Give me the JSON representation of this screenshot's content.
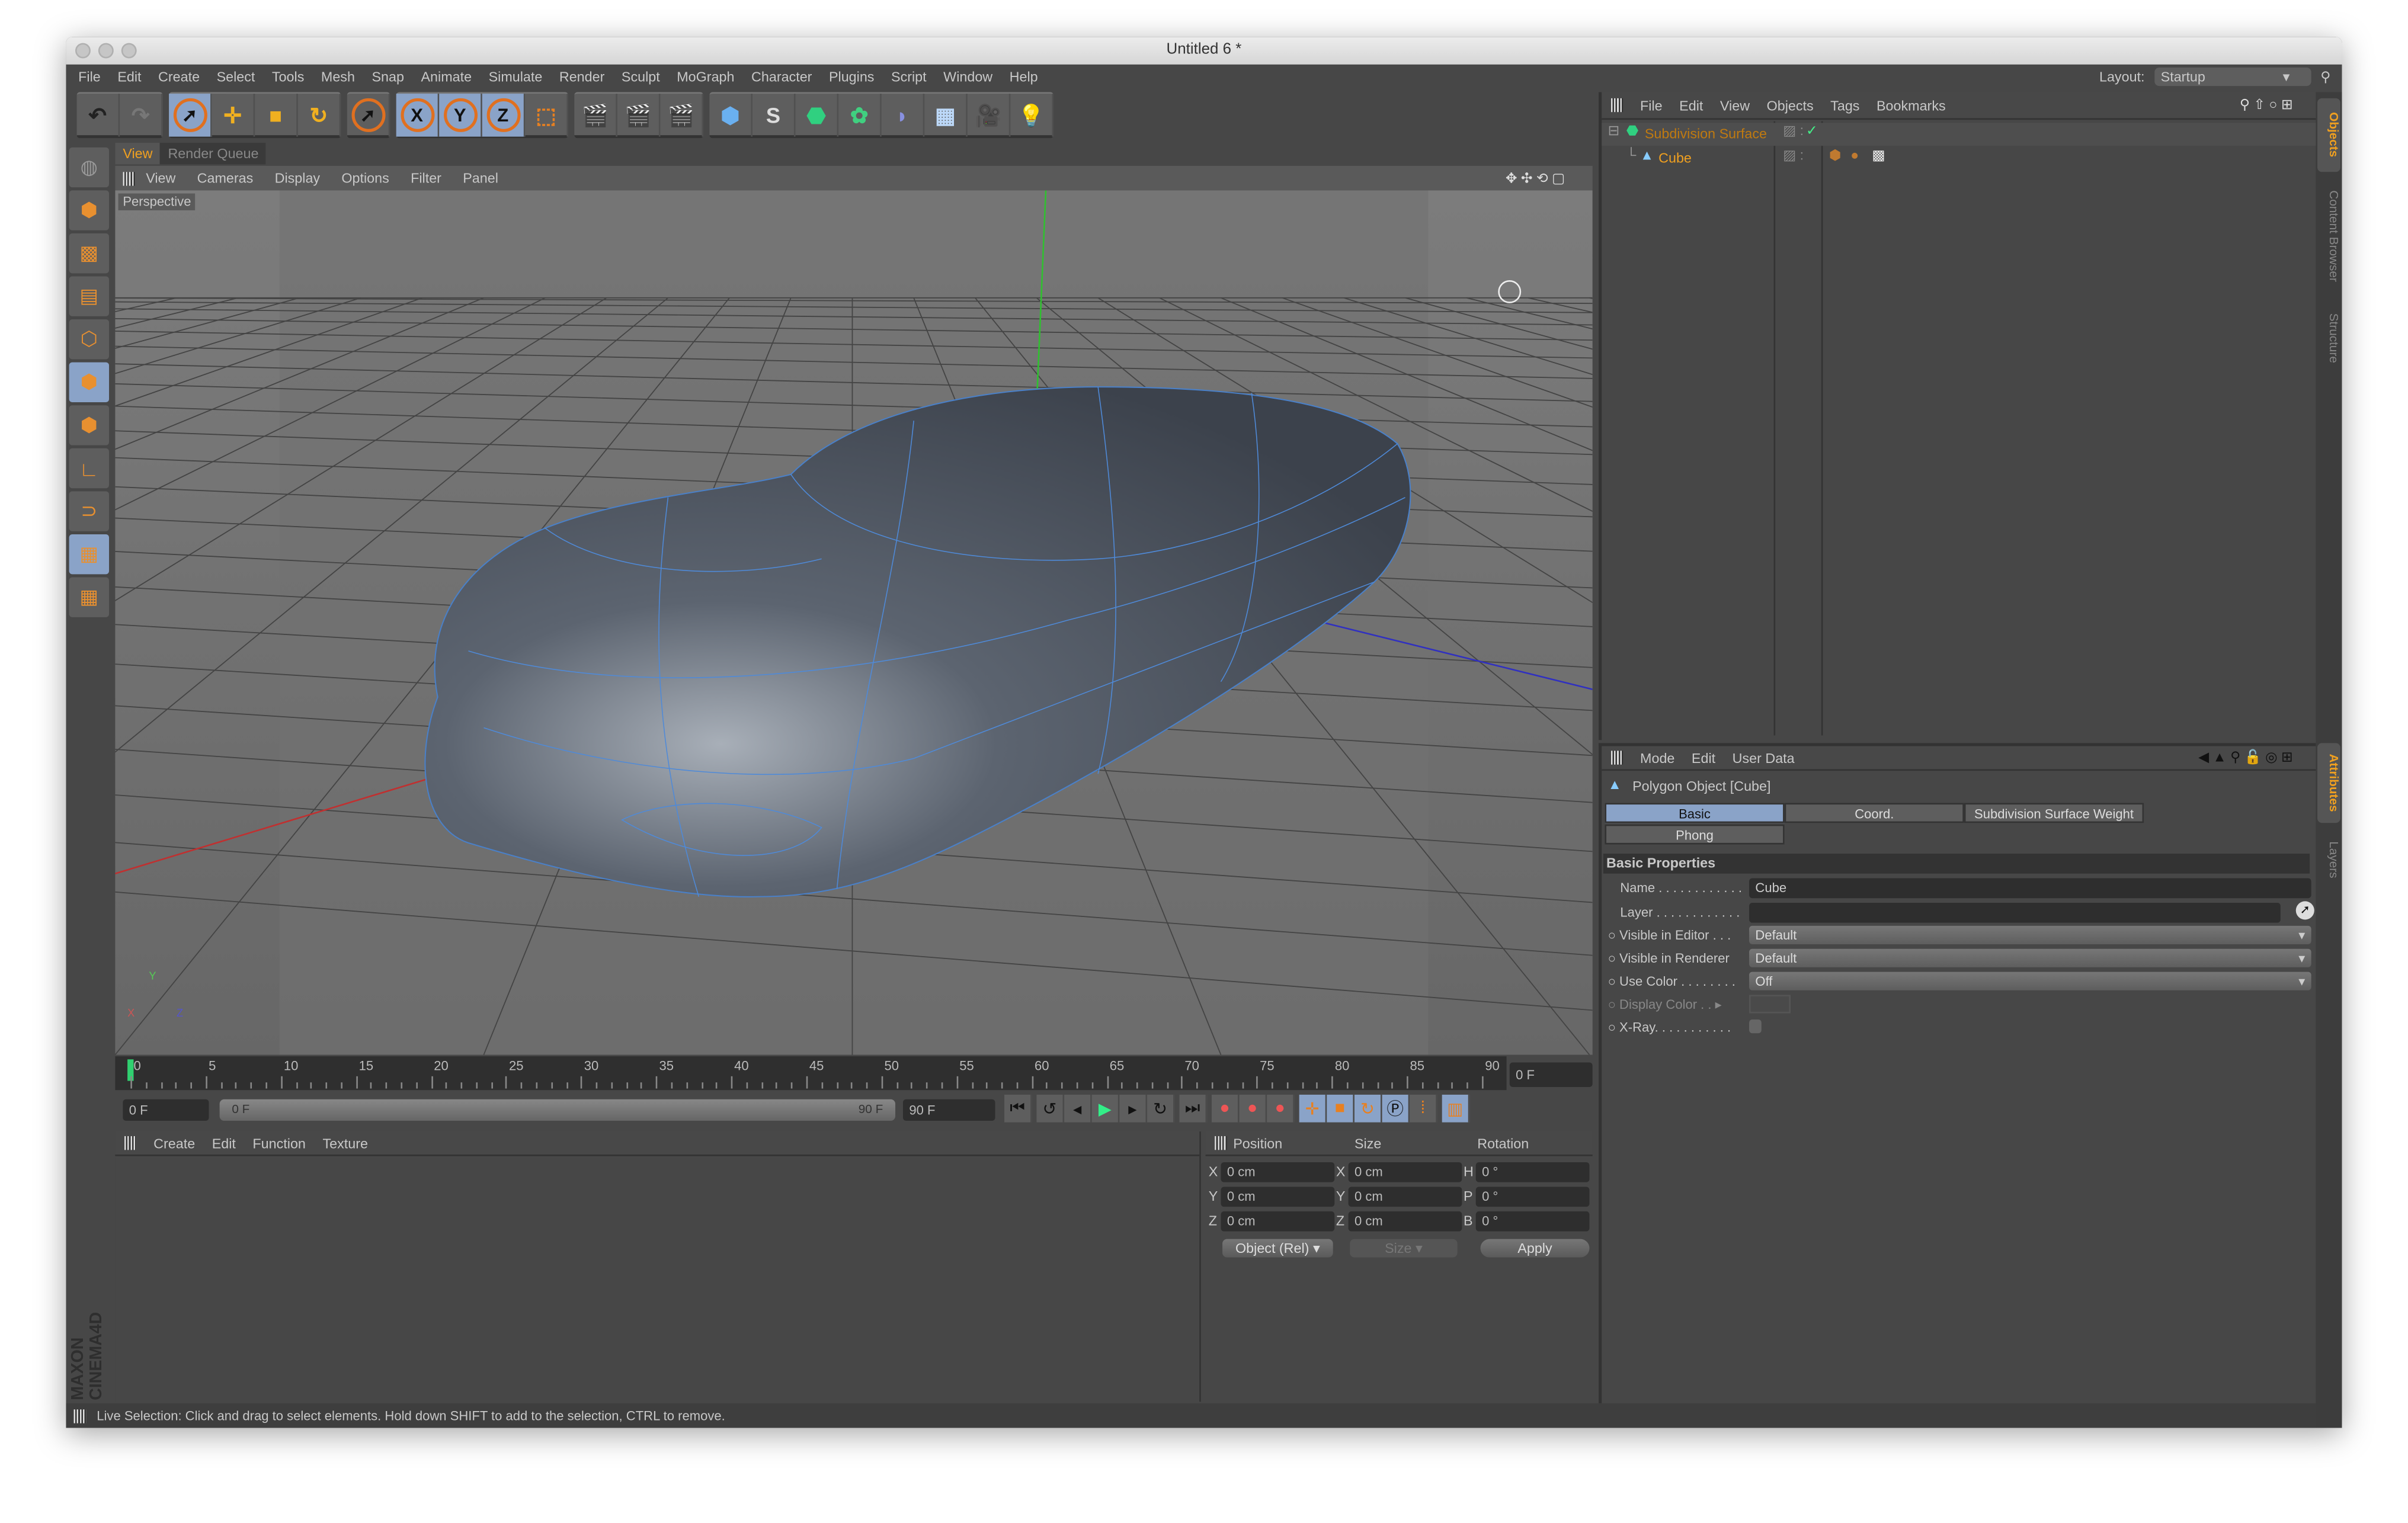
{
  "window": {
    "title": "Untitled 6 *"
  },
  "menu": [
    "File",
    "Edit",
    "Create",
    "Select",
    "Tools",
    "Mesh",
    "Snap",
    "Animate",
    "Simulate",
    "Render",
    "Sculpt",
    "MoGraph",
    "Character",
    "Plugins",
    "Script",
    "Window",
    "Help"
  ],
  "layout": {
    "label": "Layout:",
    "value": "Startup"
  },
  "toolbar": {
    "axis_x": "X",
    "axis_y": "Y",
    "axis_z": "Z"
  },
  "view_tabs": [
    "View",
    "Render Queue"
  ],
  "view_menu": [
    "View",
    "Cameras",
    "Display",
    "Options",
    "Filter",
    "Panel"
  ],
  "viewport": {
    "label": "Perspective",
    "axis_y": "Y",
    "axis_x": "X",
    "axis_z": "Z"
  },
  "timeline": {
    "ticks": [
      "0",
      "5",
      "10",
      "15",
      "20",
      "25",
      "30",
      "35",
      "40",
      "45",
      "50",
      "55",
      "60",
      "65",
      "70",
      "75",
      "80",
      "85",
      "90"
    ],
    "current": "0 F",
    "start": "0 F",
    "range_start": "0 F",
    "range_end": "90 F",
    "end": "90 F",
    "current_progress": 0
  },
  "material_menu": [
    "Create",
    "Edit",
    "Function",
    "Texture"
  ],
  "coords": {
    "headers": [
      "Position",
      "Size",
      "Rotation"
    ],
    "rows": [
      {
        "pl": "X",
        "pv": "0 cm",
        "sl": "X",
        "sv": "0 cm",
        "rl": "H",
        "rv": "0 °"
      },
      {
        "pl": "Y",
        "pv": "0 cm",
        "sl": "Y",
        "sv": "0 cm",
        "rl": "P",
        "rv": "0 °"
      },
      {
        "pl": "Z",
        "pv": "0 cm",
        "sl": "Z",
        "sv": "0 cm",
        "rl": "B",
        "rv": "0 °"
      }
    ],
    "mode": "Object (Rel)",
    "size_mode": "Size",
    "apply": "Apply"
  },
  "objects_menu": [
    "File",
    "Edit",
    "View",
    "Objects",
    "Tags",
    "Bookmarks"
  ],
  "objects": [
    {
      "name": "Subdivision Surface",
      "color": "#c07a10"
    },
    {
      "name": "Cube",
      "color": "#f0a020"
    }
  ],
  "right_tabs": [
    "Objects",
    "Content Browser",
    "Structure",
    "Attributes",
    "Layers"
  ],
  "attr_menu": [
    "Mode",
    "Edit",
    "User Data"
  ],
  "attr": {
    "title": "Polygon Object [Cube]",
    "tabs": [
      "Basic",
      "Coord.",
      "Subdivision Surface Weight",
      "Phong"
    ],
    "section": "Basic Properties",
    "props": [
      {
        "label": "Name . . . . . . . . . . . .",
        "value": "Cube"
      },
      {
        "label": "Layer . . . . . . . . . . . .",
        "value": ""
      },
      {
        "label": "Visible in Editor . . .",
        "value": "Default"
      },
      {
        "label": "Visible in Renderer",
        "value": "Default"
      },
      {
        "label": "Use Color . . . . . . . .",
        "value": "Off"
      },
      {
        "label": "Display Color . .",
        "value": ""
      },
      {
        "label": "X-Ray. . . . . . . . . . .",
        "value": ""
      }
    ]
  },
  "status": "Live Selection: Click and drag to select elements. Hold down SHIFT to add to the selection, CTRL to remove.",
  "brand": "MAXON CINEMA4D",
  "colors": {
    "accent": "#f0a020",
    "selected": "#8aa3c8",
    "panel": "#474747"
  }
}
